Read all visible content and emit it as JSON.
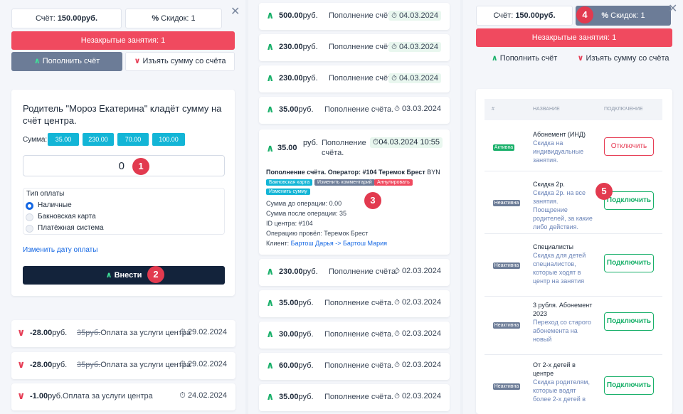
{
  "left": {
    "balance_label": "Счёт:",
    "balance_value": "150.00руб.",
    "discount_label": "Скидок: 1",
    "unclosed_label": "Незакрытые занятия: 1",
    "topup_label": "Пополнить счёт",
    "withdraw_label": "Изъять сумму со счёта",
    "form": {
      "title": "Родитель \"Мороз Екатерина\" кладёт сумму на счёт центра.",
      "sum_label": "Сумма:",
      "chips": [
        "35.00",
        "230.00",
        "70.00",
        "100.00"
      ],
      "amount_value": "0",
      "payment_type_label": "Тип оплаты",
      "payment_options": [
        "Наличные",
        "Бакновская карта",
        "Платёжная система"
      ],
      "change_date_link": "Изменить дату оплаты",
      "submit_label": "Внести"
    },
    "history": [
      {
        "amount": "-28.00",
        "unit": "руб.",
        "strike": "35руб.",
        "desc": "Оплата за услуги центра",
        "date": "29.02.2024"
      },
      {
        "amount": "-28.00",
        "unit": "руб.",
        "strike": "35руб.",
        "desc": "Оплата за услуги центра",
        "date": "29.02.2024"
      },
      {
        "amount": "-1.00",
        "unit": "руб.",
        "strike": "",
        "desc": "Оплата за услуги центра",
        "date": "24.02.2024"
      }
    ]
  },
  "middle": {
    "rows_top": [
      {
        "amount": "500.00",
        "unit": "руб.",
        "desc": "Пополнение счёта.",
        "date": "04.03.2024"
      },
      {
        "amount": "230.00",
        "unit": "руб.",
        "desc": "Пополнение счёта.",
        "date": "04.03.2024"
      },
      {
        "amount": "230.00",
        "unit": "руб.",
        "desc": "Пополнение счёта.",
        "date": "04.03.2024"
      },
      {
        "amount": "35.00",
        "unit": "руб.",
        "desc": "Пополнение счёта.",
        "date": "03.03.2024"
      }
    ],
    "expanded": {
      "amount": "35.00",
      "unit": "руб.",
      "desc_line1": "Пополнение",
      "desc_line2": "счёта.",
      "date": "04.03.2024 10:55",
      "title": "Пополнение счёта. Оператор: #104 Теремок Брест",
      "currency": "BYN",
      "tags": [
        "Бакновская карта",
        "Изменить комментарий",
        "Аннулировать",
        "Изменить сумму"
      ],
      "before": "Сумма до операции: 0.00",
      "after": "Сумма после операции: 35",
      "center": "ID центра: #104",
      "operator": "Операцию провёл: Теремок Брест",
      "client_label": "Клиент:",
      "client_link": "Бартош Дарья -> Бартош Мария"
    },
    "rows_bottom": [
      {
        "amount": "230.00",
        "unit": "руб.",
        "desc": "Пополнение счёта.",
        "date": "02.03.2024"
      },
      {
        "amount": "35.00",
        "unit": "руб.",
        "desc": "Пополнение счёта.",
        "date": "02.03.2024"
      },
      {
        "amount": "30.00",
        "unit": "руб.",
        "desc": "Пополнение счёта.",
        "date": "02.03.2024"
      },
      {
        "amount": "60.00",
        "unit": "руб.",
        "desc": "Пополнение счёта.",
        "date": "02.03.2024"
      },
      {
        "amount": "35.00",
        "unit": "руб.",
        "desc": "Пополнение счёта.",
        "date": "02.03.2024"
      }
    ]
  },
  "right": {
    "balance_label": "Счёт:",
    "balance_value": "150.00руб.",
    "discount_label": "Скидок: 1",
    "unclosed_label": "Незакрытые занятия: 1",
    "topup_label": "Пополнить счёт",
    "withdraw_label": "Изъять сумму со счёта",
    "table_headers": [
      "#",
      "НАЗВАНИЕ",
      "ПОДКЛЮЧЕНИЕ"
    ],
    "discounts": [
      {
        "status": "Активна",
        "name": "Абонемент (ИНД)",
        "desc": "Скидка на индивидуальные занятия.",
        "button": "Отключить",
        "active": true
      },
      {
        "status": "Неактивна",
        "name": "Скидка 2р.",
        "desc": "Скидка 2р. на все занятия. Поощрение родителей, за какие либо действия.",
        "button": "Подключить",
        "active": false
      },
      {
        "status": "Неактивна",
        "name": "Специалисты",
        "desc": "Скидка для детей специалистов, которые ходят в центр на занятия",
        "button": "Подключить",
        "active": false
      },
      {
        "status": "Неактивна",
        "name": "3 рубля. Абонемент 2023",
        "desc": "Переход со старого абонемента на новый",
        "button": "Подключить",
        "active": false
      },
      {
        "status": "Неактивна",
        "name": "От 2-х детей в центре",
        "desc": "Скидка родителям, которые водят более 2-х детей в",
        "button": "Подключить",
        "active": false
      }
    ]
  },
  "markers": [
    "1",
    "2",
    "3",
    "4",
    "5"
  ],
  "colors": {
    "accent_red": "#f04a5f",
    "accent_grey": "#6c7c97",
    "accent_green": "#19b06a",
    "accent_blue": "#1668e3",
    "chip_cyan": "#13b5d6",
    "dark_button": "#13233b"
  }
}
